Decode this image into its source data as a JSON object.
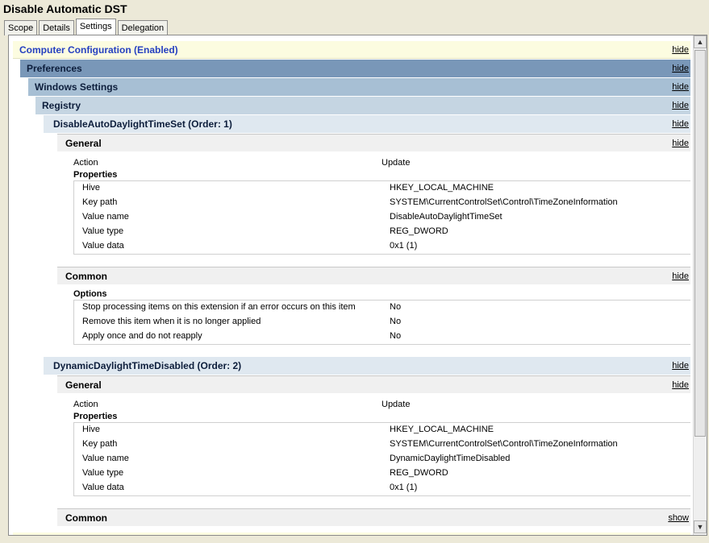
{
  "window": {
    "title": "Disable Automatic DST"
  },
  "tabs": [
    {
      "label": "Scope"
    },
    {
      "label": "Details"
    },
    {
      "label": "Settings"
    },
    {
      "label": "Delegation"
    }
  ],
  "report": {
    "computer_config": {
      "label": "Computer Configuration (Enabled)",
      "link": "hide"
    },
    "preferences": {
      "label": "Preferences",
      "link": "hide"
    },
    "windows_settings": {
      "label": "Windows Settings",
      "link": "hide"
    },
    "registry": {
      "label": "Registry",
      "link": "hide"
    },
    "items": [
      {
        "label": "DisableAutoDaylightTimeSet (Order: 1)",
        "link": "hide",
        "general": {
          "label": "General",
          "link": "hide",
          "action_label": "Action",
          "action_value": "Update",
          "properties_label": "Properties",
          "properties": [
            {
              "name": "Hive",
              "value": "HKEY_LOCAL_MACHINE"
            },
            {
              "name": "Key path",
              "value": "SYSTEM\\CurrentControlSet\\Control\\TimeZoneInformation"
            },
            {
              "name": "Value name",
              "value": "DisableAutoDaylightTimeSet"
            },
            {
              "name": "Value type",
              "value": "REG_DWORD"
            },
            {
              "name": "Value data",
              "value": "0x1 (1)"
            }
          ]
        },
        "common": {
          "label": "Common",
          "link": "hide",
          "options_label": "Options",
          "options": [
            {
              "name": "Stop processing items on this extension if an error occurs on this item",
              "value": "No"
            },
            {
              "name": "Remove this item when it is no longer applied",
              "value": "No"
            },
            {
              "name": "Apply once and do not reapply",
              "value": "No"
            }
          ]
        }
      },
      {
        "label": "DynamicDaylightTimeDisabled (Order: 2)",
        "link": "hide",
        "general": {
          "label": "General",
          "link": "hide",
          "action_label": "Action",
          "action_value": "Update",
          "properties_label": "Properties",
          "properties": [
            {
              "name": "Hive",
              "value": "HKEY_LOCAL_MACHINE"
            },
            {
              "name": "Key path",
              "value": "SYSTEM\\CurrentControlSet\\Control\\TimeZoneInformation"
            },
            {
              "name": "Value name",
              "value": "DynamicDaylightTimeDisabled"
            },
            {
              "name": "Value type",
              "value": "REG_DWORD"
            },
            {
              "name": "Value data",
              "value": "0x1 (1)"
            }
          ]
        },
        "common": {
          "label": "Common",
          "link": "show"
        }
      }
    ]
  },
  "colors": {
    "computer_config_bg": "#fcfce0",
    "preferences_bg": "#7997b8",
    "windows_settings_bg": "#a7bfd4",
    "registry_bg": "#c5d5e2",
    "item_bg": "#dfe8f0",
    "section_bg": "#f0f0f0",
    "link_blue": "#2540c0"
  }
}
